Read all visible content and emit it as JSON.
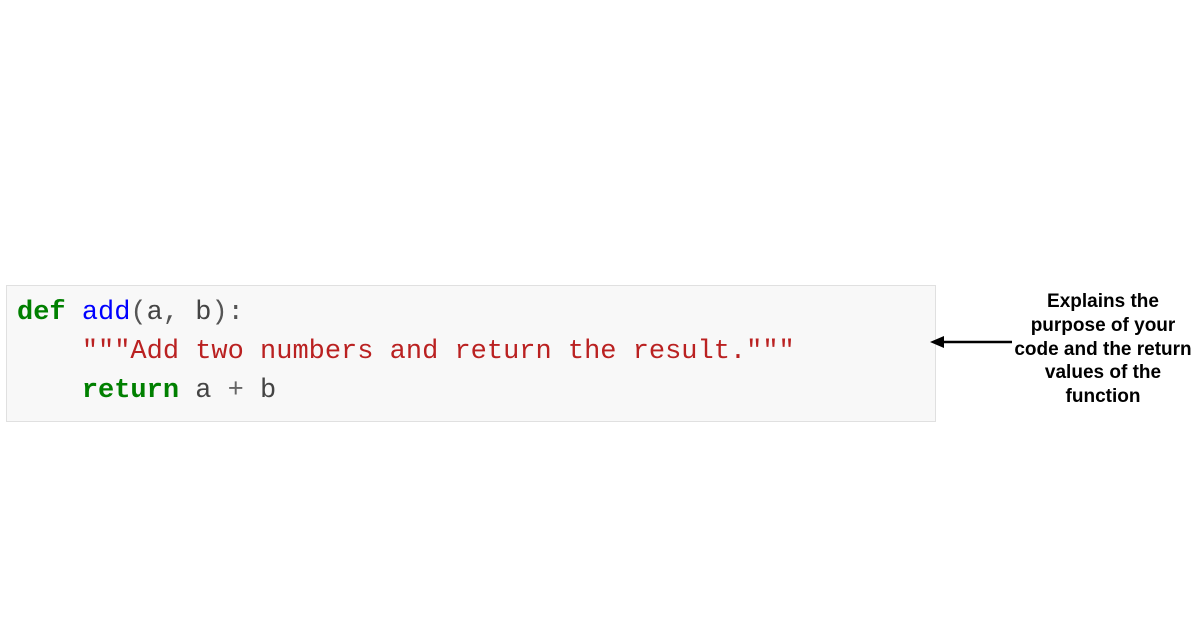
{
  "code": {
    "line1": {
      "def": "def",
      "space1": " ",
      "func": "add",
      "open": "(",
      "a": "a",
      "comma": ",",
      "space2": " ",
      "b": "b",
      "close": ")",
      "colon": ":"
    },
    "line2": {
      "indent": "    ",
      "docstring": "\"\"\"Add two numbers and return the result.\"\"\""
    },
    "line3": {
      "indent": "    ",
      "ret": "return",
      "space1": " ",
      "a": "a",
      "space2": " ",
      "plus": "+",
      "space3": " ",
      "b": "b"
    }
  },
  "annotation": {
    "text": "Explains the purpose of your code and the return values of the function"
  }
}
